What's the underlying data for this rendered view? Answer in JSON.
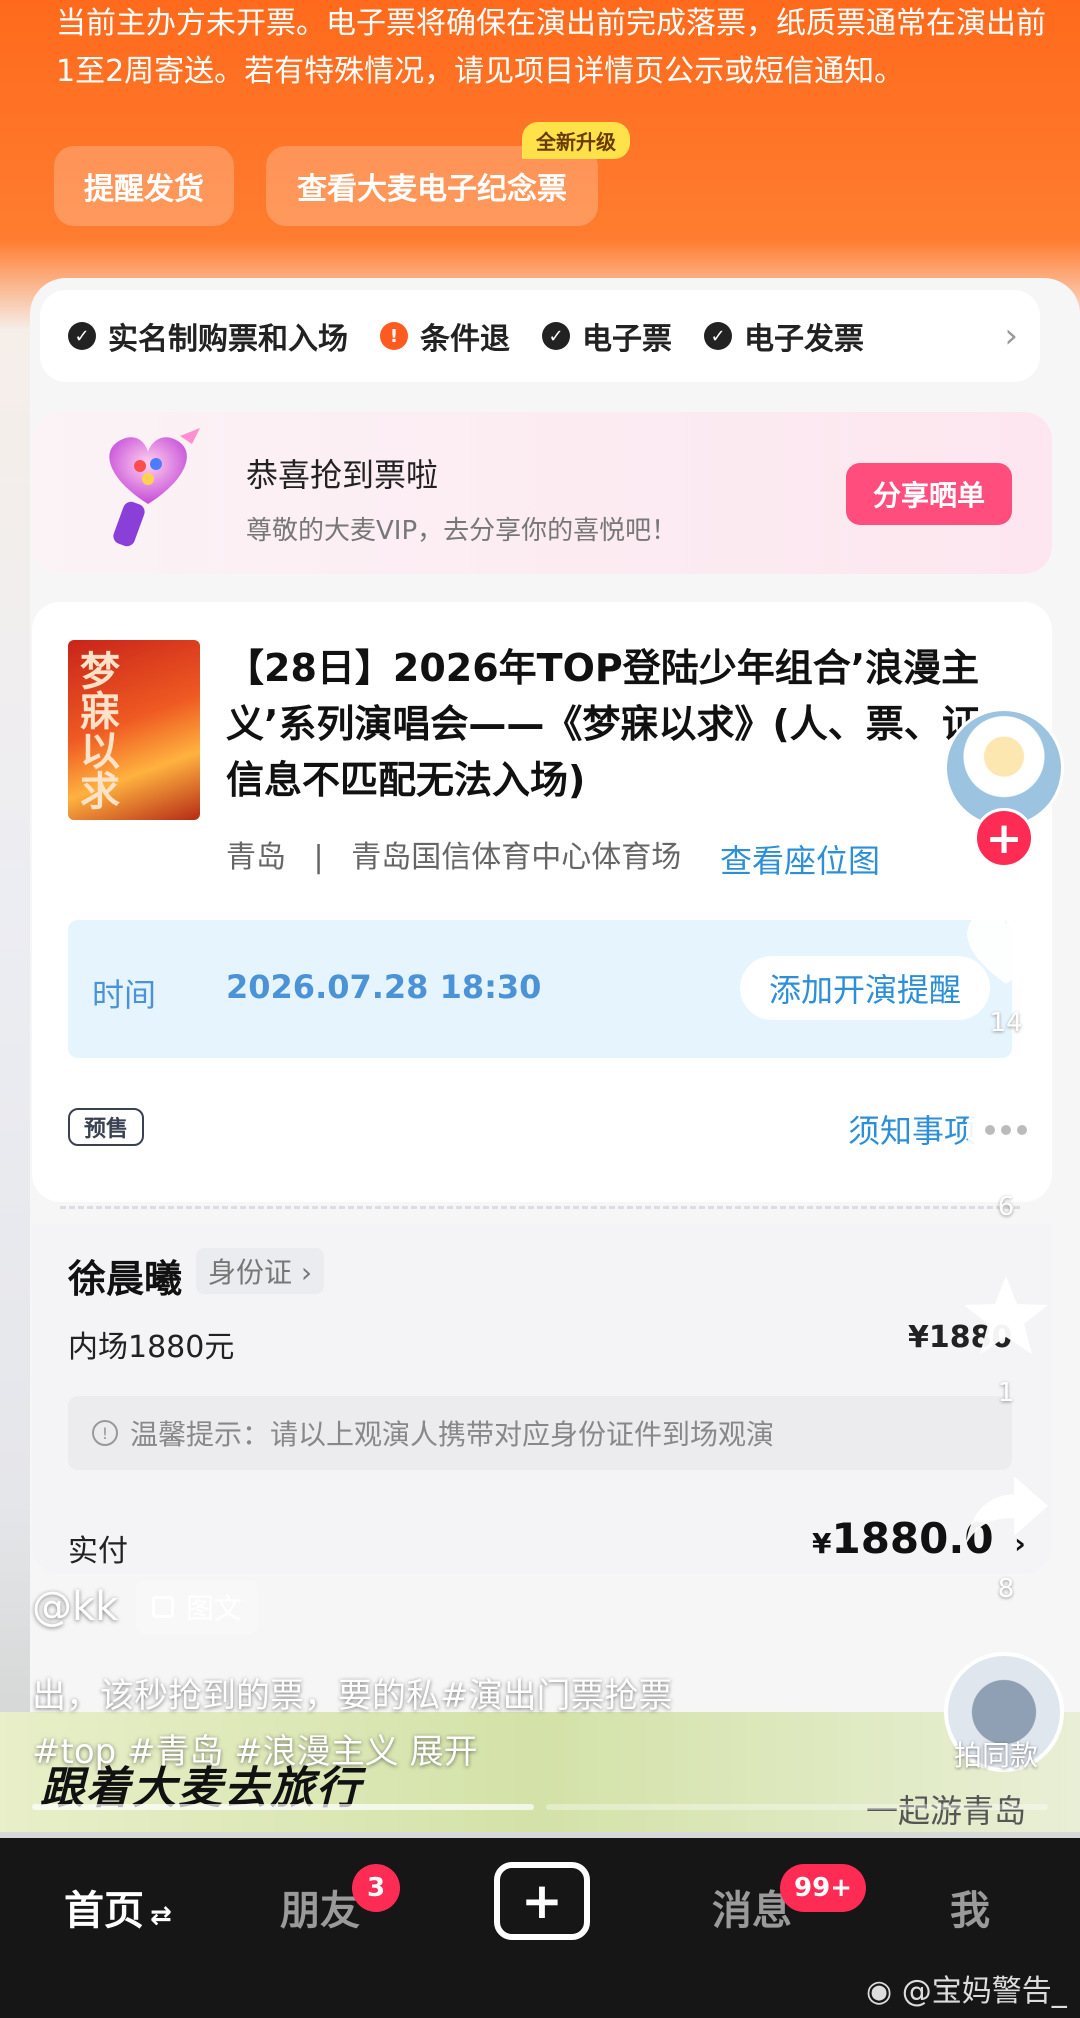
{
  "notice": {
    "text": "当前主办方未开票。电子票将确保在演出前完成落票，纸质票通常在演出前1至2周寄送。若有特殊情况，请见项目详情页公示或短信通知。",
    "remind_ship_label": "提醒发货",
    "souvenir_label": "查看大麦电子纪念票",
    "new_badge": "全新升级"
  },
  "features": [
    {
      "label": "实名制购票和入场",
      "icon": "check-icon"
    },
    {
      "label": "条件退",
      "icon": "warning-icon"
    },
    {
      "label": "电子票",
      "icon": "check-icon"
    },
    {
      "label": "电子发票",
      "icon": "check-icon"
    }
  ],
  "share": {
    "title": "恭喜抢到票啦",
    "subtitle": "尊敬的大麦VIP，去分享你的喜悦吧！",
    "button": "分享晒单"
  },
  "event": {
    "poster_text": "梦寐以求",
    "title": "【28日】2026年TOP登陆少年组合’浪漫主义’系列演唱会——《梦寐以求》(人、票、证信息不匹配无法入场)",
    "city": "青岛",
    "separator": "|",
    "venue": "青岛国信体育中心体育场",
    "seat_map_link": "查看座位图",
    "time_label": "时间",
    "time_value": "2026.07.28 18:30",
    "remind_button": "添加开演提醒",
    "presale_tag": "预售",
    "notice_link": "须知事项"
  },
  "ticket": {
    "holder_name": "徐晨曦",
    "id_type": "身份证 ›",
    "seat_area": "内场1880元",
    "price": "¥1880",
    "tip": "温馨提示：请以上观演人携带对应身份证件到场观演",
    "paid_label": "实付",
    "paid_currency": "¥",
    "paid_value": "1880.0",
    "paid_arrow": "›"
  },
  "promo": {
    "left_text": "跟着大麦去旅行",
    "right_text": "一起游青岛"
  },
  "overlay": {
    "handle": "@kk",
    "type_tag": "图文",
    "caption_line1": "出，该秒抢到的票，要的私#演出门票抢票",
    "caption_line2": "#top #青岛 #浪漫主义  展开",
    "like_count": "14",
    "comment_count": "6",
    "fav_count": "1",
    "share_count": "8",
    "same_style": "拍同款"
  },
  "nav": {
    "home": "首页",
    "friends": "朋友",
    "friends_badge": "3",
    "messages": "消息",
    "messages_badge": "99+",
    "me": "我"
  },
  "watermark": "@宝妈警告_",
  "colors": {
    "brand_orange": "#ff6a1c",
    "link_blue": "#2d8fd8",
    "share_pink": "#ff4d7e",
    "tiktok_red": "#fe2c55"
  }
}
